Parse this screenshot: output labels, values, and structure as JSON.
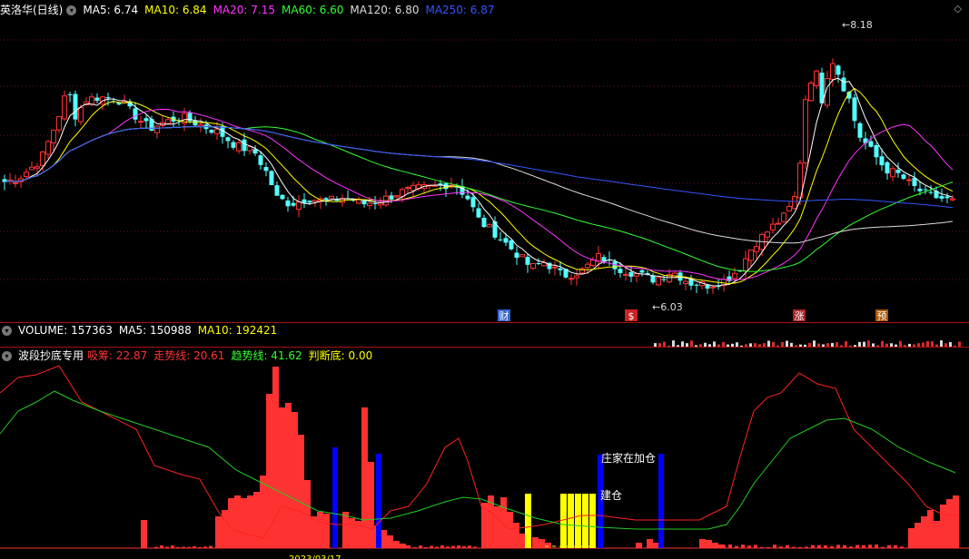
{
  "main": {
    "title": "英洛华(日线)",
    "ma_items": [
      {
        "label": "MA5: 6.74",
        "color": "#ffffff"
      },
      {
        "label": "MA10: 6.84",
        "color": "#ffff00"
      },
      {
        "label": "MA20: 7.15",
        "color": "#ff33ff"
      },
      {
        "label": "MA60: 6.60",
        "color": "#33ff33"
      },
      {
        "label": "MA120: 6.80",
        "color": "#dddddd"
      },
      {
        "label": "MA250: 6.87",
        "color": "#3355ff"
      }
    ],
    "high_label": "8.18",
    "low_label": "6.03",
    "markers": [
      {
        "text": "财",
        "bg": "#3366cc"
      },
      {
        "text": "$",
        "bg": "#cc2222"
      },
      {
        "text": "涨",
        "bg": "#aa2222"
      },
      {
        "text": "预",
        "bg": "#aa5500"
      }
    ],
    "diamond": "◇",
    "price_range": [
      5.9,
      8.4
    ]
  },
  "volume": {
    "title": "VOLUME: 157363",
    "ma5": "MA5: 150988",
    "ma10": "MA10: 192421"
  },
  "indicator": {
    "title": "波段抄底专用",
    "items": [
      {
        "label": "吸筹: 22.87",
        "color": "#ff3333"
      },
      {
        "label": "走势线: 20.61",
        "color": "#ff3333"
      },
      {
        "label": "趋势线: 41.62",
        "color": "#33ff33"
      },
      {
        "label": "判断底: 0.00",
        "color": "#ffff00"
      }
    ],
    "annotations": [
      "庄家在加仓",
      "建仓"
    ],
    "date_label": "2023/03/17"
  },
  "colors": {
    "up": "#ff3232",
    "down": "#54ffff",
    "bg": "#000000",
    "grid": "#6b1515"
  }
}
